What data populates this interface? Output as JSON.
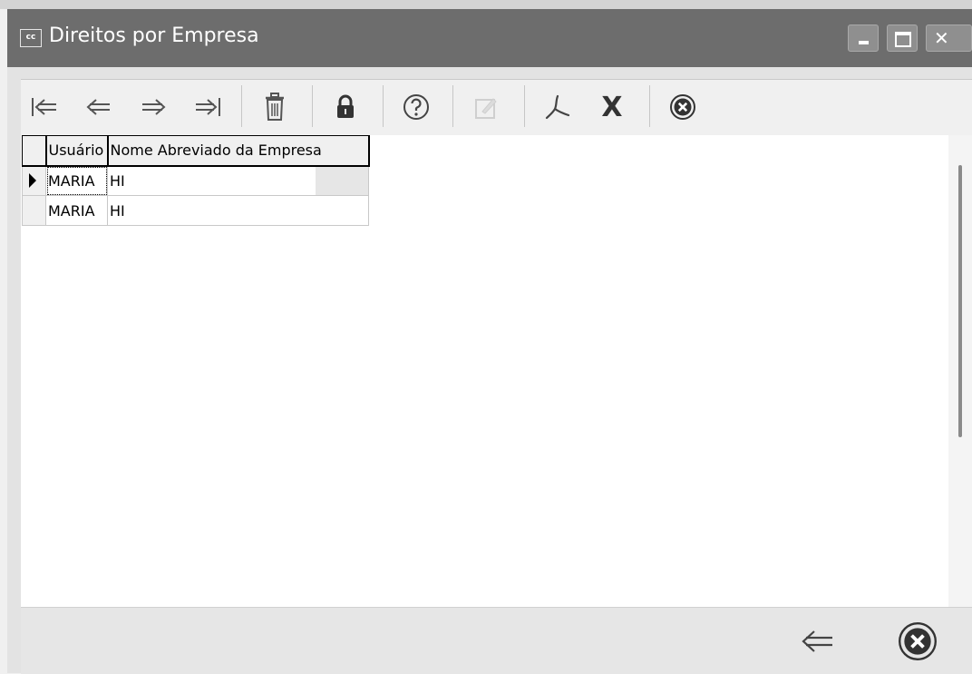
{
  "window": {
    "title": "Direitos por Empresa",
    "app_icon_text": "cc"
  },
  "toolbar": {
    "buttons": [
      {
        "name": "first-record",
        "icon": "first-record-icon"
      },
      {
        "name": "previous-record",
        "icon": "previous-record-icon"
      },
      {
        "name": "next-record",
        "icon": "next-record-icon"
      },
      {
        "name": "last-record",
        "icon": "last-record-icon"
      },
      {
        "name": "delete",
        "icon": "trash-icon"
      },
      {
        "name": "lock",
        "icon": "lock-icon"
      },
      {
        "name": "help",
        "icon": "help-icon"
      },
      {
        "name": "edit",
        "icon": "edit-icon",
        "disabled": true
      },
      {
        "name": "pdf",
        "icon": "pdf-icon"
      },
      {
        "name": "excel",
        "icon": "excel-x-icon",
        "label": "X"
      },
      {
        "name": "close",
        "icon": "close-circle-icon"
      }
    ]
  },
  "grid": {
    "columns": [
      "Usuário",
      "Nome Abreviado da Empresa"
    ],
    "rows": [
      {
        "usuario": "MARIA",
        "empresa": "HI",
        "current": true
      },
      {
        "usuario": "MARIA",
        "empresa": "HI",
        "current": false
      }
    ]
  },
  "bottom": {
    "buttons": [
      {
        "name": "back",
        "icon": "back-arrow-icon"
      },
      {
        "name": "cancel",
        "icon": "close-circle-icon"
      }
    ]
  },
  "colors": {
    "titlebar": "#6d6d6d",
    "toolbar_bg": "#f0f0f0",
    "grid_bg": "#ffffff",
    "bottom_bg": "#e6e6e6"
  }
}
